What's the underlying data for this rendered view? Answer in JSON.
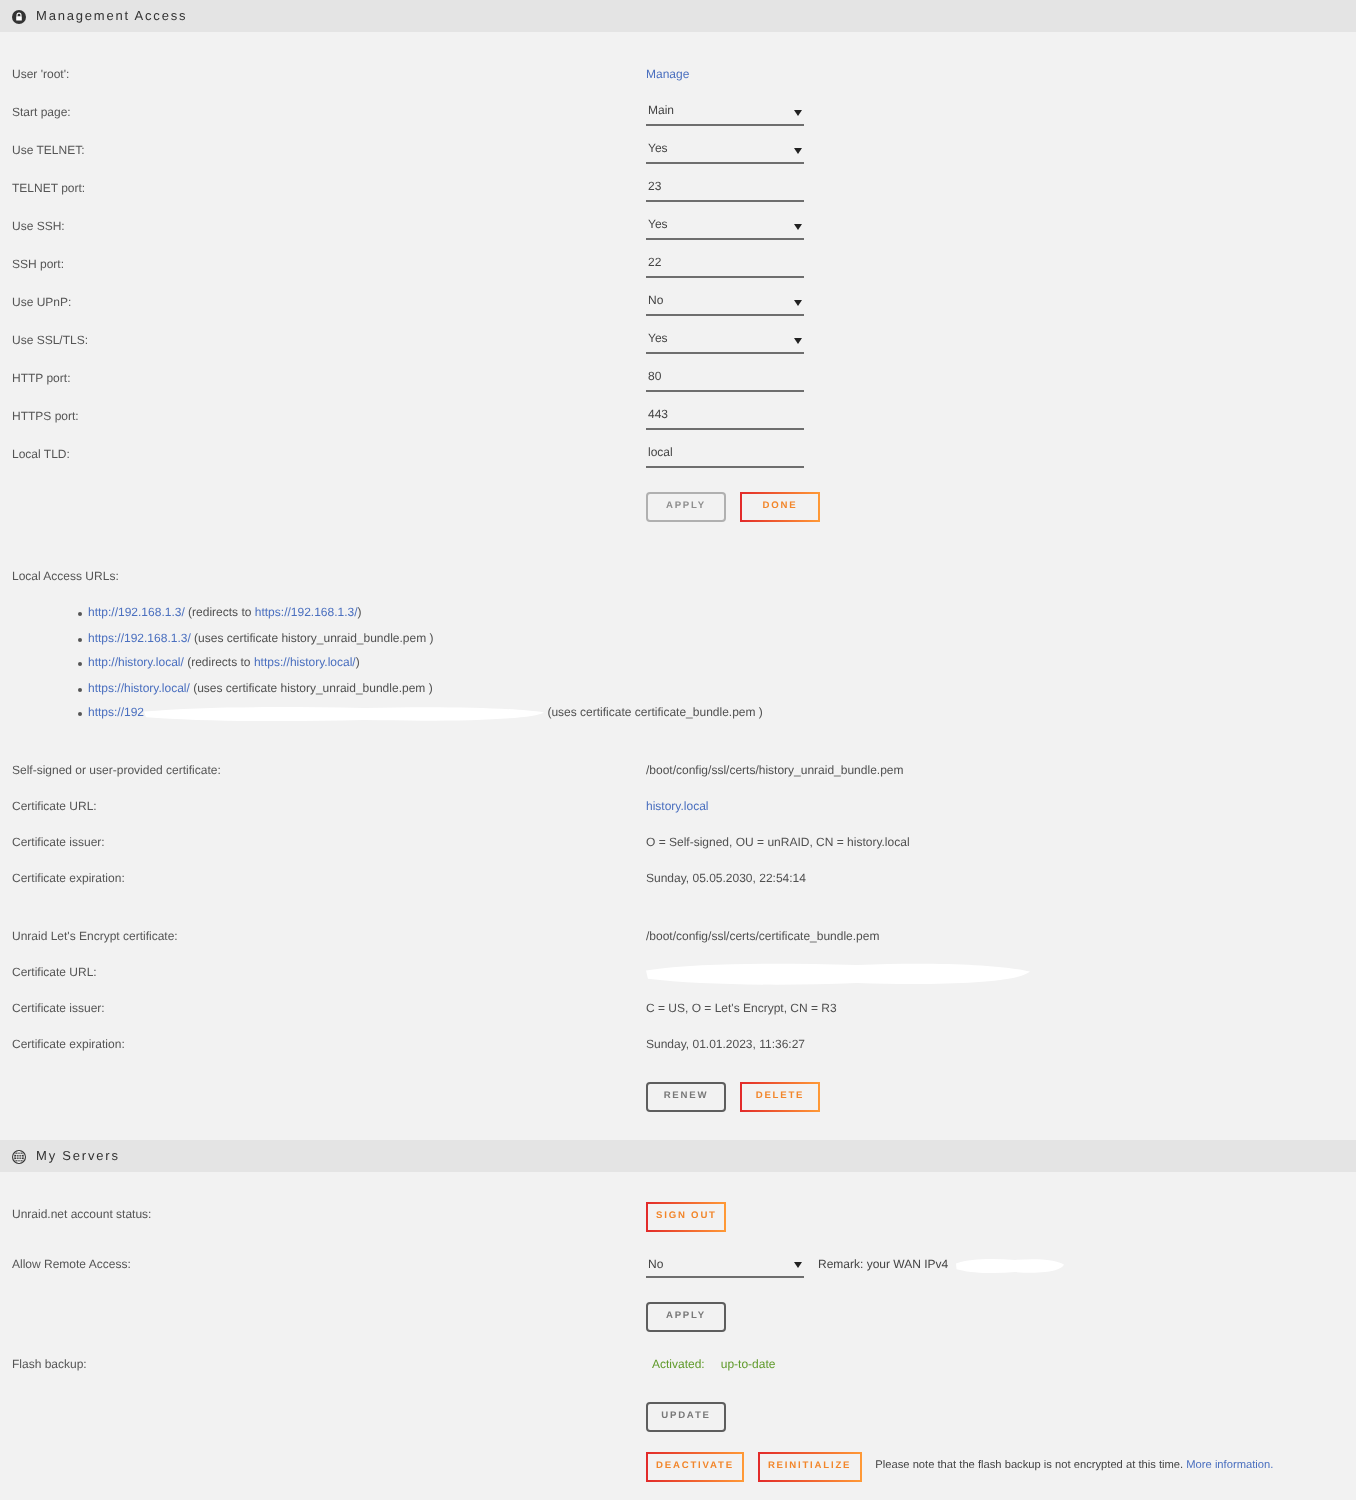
{
  "management_access": {
    "title": "Management Access",
    "settings": [
      {
        "label": "User 'root':",
        "kind": "link",
        "value": "Manage"
      },
      {
        "label": "Start page:",
        "kind": "select",
        "value": "Main"
      },
      {
        "label": "Use TELNET:",
        "kind": "select",
        "value": "Yes"
      },
      {
        "label": "TELNET port:",
        "kind": "input",
        "value": "23"
      },
      {
        "label": "Use SSH:",
        "kind": "select",
        "value": "Yes"
      },
      {
        "label": "SSH port:",
        "kind": "input",
        "value": "22"
      },
      {
        "label": "Use UPnP:",
        "kind": "select",
        "value": "No"
      },
      {
        "label": "Use SSL/TLS:",
        "kind": "select",
        "value": "Yes"
      },
      {
        "label": "HTTP port:",
        "kind": "input",
        "value": "80"
      },
      {
        "label": "HTTPS port:",
        "kind": "input",
        "value": "443"
      },
      {
        "label": "Local TLD:",
        "kind": "input",
        "value": "local"
      }
    ],
    "buttons": [
      {
        "label": "APPLY",
        "kind": "default",
        "disabled": true
      },
      {
        "label": "DONE",
        "kind": "accent",
        "disabled": false
      }
    ],
    "local_access": {
      "label": "Local Access URLs:",
      "urls": [
        {
          "parts": [
            {
              "kind": "link",
              "text": "http://192.168.1.3/"
            },
            {
              "kind": "text",
              "text": " (redirects to "
            },
            {
              "kind": "link",
              "text": "https://192.168.1.3/"
            },
            {
              "kind": "text",
              "text": ")"
            }
          ]
        },
        {
          "parts": [
            {
              "kind": "link",
              "text": "https://192.168.1.3/"
            },
            {
              "kind": "text",
              "text": " (uses certificate history_unraid_bundle.pem )"
            }
          ]
        },
        {
          "parts": [
            {
              "kind": "link",
              "text": "http://history.local/"
            },
            {
              "kind": "text",
              "text": " (redirects to "
            },
            {
              "kind": "link",
              "text": "https://history.local/"
            },
            {
              "kind": "text",
              "text": ")"
            }
          ]
        },
        {
          "parts": [
            {
              "kind": "link",
              "text": "https://history.local/"
            },
            {
              "kind": "text",
              "text": " (uses certificate history_unraid_bundle.pem )"
            }
          ]
        },
        {
          "parts": [
            {
              "kind": "link",
              "text": "https://192"
            },
            {
              "kind": "redacted"
            },
            {
              "kind": "text",
              "text": " (uses certificate certificate_bundle.pem )"
            }
          ]
        }
      ]
    },
    "certificates": [
      {
        "rows": [
          {
            "label": "Self-signed or user-provided certificate:",
            "kind": "text",
            "value": "/boot/config/ssl/certs/history_unraid_bundle.pem"
          },
          {
            "label": "Certificate URL:",
            "kind": "link",
            "value": "history.local"
          },
          {
            "label": "Certificate issuer:",
            "kind": "text",
            "value": "O = Self-signed, OU = unRAID, CN = history.local"
          },
          {
            "label": "Certificate expiration:",
            "kind": "text",
            "value": "Sunday, 05.05.2030, 22:54:14"
          }
        ]
      },
      {
        "rows": [
          {
            "label": "Unraid Let's Encrypt certificate:",
            "kind": "text",
            "value": "/boot/config/ssl/certs/certificate_bundle.pem"
          },
          {
            "label": "Certificate URL:",
            "kind": "redacted"
          },
          {
            "label": "Certificate issuer:",
            "kind": "text",
            "value": "C = US, O = Let's Encrypt, CN = R3"
          },
          {
            "label": "Certificate expiration:",
            "kind": "text",
            "value": "Sunday, 01.01.2023, 11:36:27"
          }
        ],
        "buttons": [
          {
            "label": "RENEW",
            "kind": "default",
            "disabled": false
          },
          {
            "label": "DELETE",
            "kind": "accent",
            "disabled": false
          }
        ]
      }
    ]
  },
  "my_servers": {
    "title": "My Servers",
    "rows": [
      {
        "label": "Unraid.net account status:",
        "kind": "buttons",
        "buttons": [
          {
            "label": "SIGN OUT",
            "kind": "accent",
            "disabled": false
          }
        ]
      },
      {
        "label": "Allow Remote Access:",
        "kind": "select",
        "value": "No",
        "remark": "Remark: your WAN IPv4",
        "redacted": true
      },
      {
        "kind": "buttons",
        "buttons": [
          {
            "label": "APPLY",
            "kind": "default",
            "disabled": false
          }
        ]
      },
      {
        "label": "Flash backup:",
        "kind": "status",
        "status_label": "Activated:",
        "value": "up-to-date"
      },
      {
        "kind": "buttons",
        "buttons": [
          {
            "label": "UPDATE",
            "kind": "default",
            "disabled": false
          }
        ]
      },
      {
        "kind": "buttons",
        "buttons": [
          {
            "label": "DEACTIVATE",
            "kind": "accent",
            "disabled": false
          },
          {
            "label": "REINITIALIZE",
            "kind": "accent",
            "disabled": false
          }
        ],
        "note": "Please note that the flash backup is not encrypted at this time.",
        "link": "More information."
      }
    ]
  }
}
